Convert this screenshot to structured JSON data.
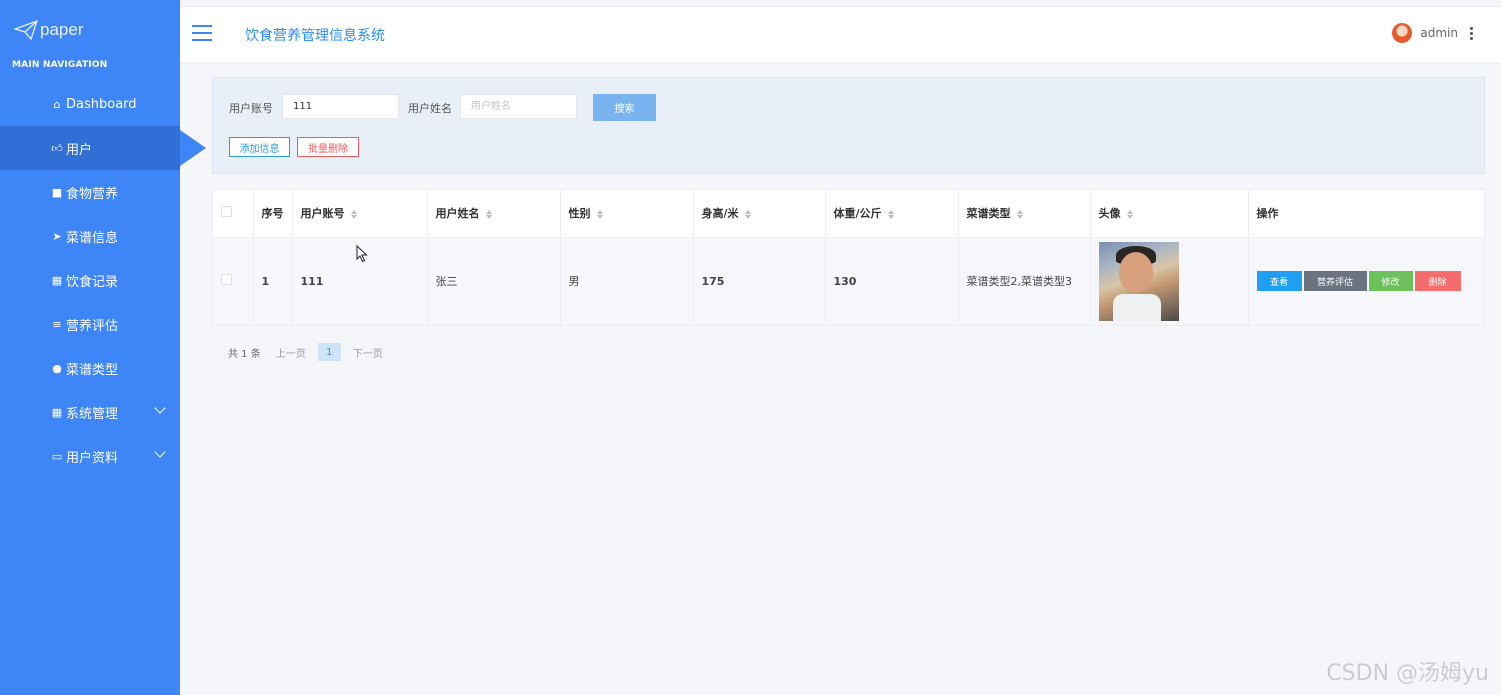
{
  "sidebar": {
    "logo_text": "paper",
    "heading": "MAIN NAVIGATION",
    "items": [
      {
        "label": "Dashboard",
        "icon": "home-icon"
      },
      {
        "label": "用户",
        "icon": "thumbs-up-icon"
      },
      {
        "label": "食物营养",
        "icon": "comment-icon"
      },
      {
        "label": "菜谱信息",
        "icon": "send-icon"
      },
      {
        "label": "饮食记录",
        "icon": "grid-icon"
      },
      {
        "label": "营养评估",
        "icon": "list-icon"
      },
      {
        "label": "菜谱类型",
        "icon": "user-icon"
      },
      {
        "label": "系统管理",
        "icon": "apps-icon"
      },
      {
        "label": "用户资料",
        "icon": "id-card-icon"
      }
    ],
    "active_index": 1,
    "color": "#3e86f7"
  },
  "header": {
    "title": "饮食营养管理信息系统",
    "username": "admin"
  },
  "search": {
    "account_label": "用户账号",
    "account_value": "111",
    "name_label": "用户姓名",
    "name_placeholder": "用户姓名",
    "search_button": "搜索",
    "add_button": "添加信息",
    "batch_delete_button": "批量删除"
  },
  "table": {
    "columns": [
      "序号",
      "用户账号",
      "用户姓名",
      "性别",
      "身高/米",
      "体重/公斤",
      "菜谱类型",
      "头像",
      "操作"
    ],
    "rows": [
      {
        "index": "1",
        "account": "111",
        "name": "张三",
        "gender": "男",
        "height": "175",
        "weight": "130",
        "recipe_types": "菜谱类型2,菜谱类型3"
      }
    ],
    "actions": {
      "view": "查看",
      "evaluate": "营养评估",
      "edit": "修改",
      "delete": "删除"
    }
  },
  "pager": {
    "total": "共 1 条",
    "prev": "上一页",
    "current": "1",
    "next": "下一页"
  },
  "watermark": "CSDN @汤姆yu"
}
